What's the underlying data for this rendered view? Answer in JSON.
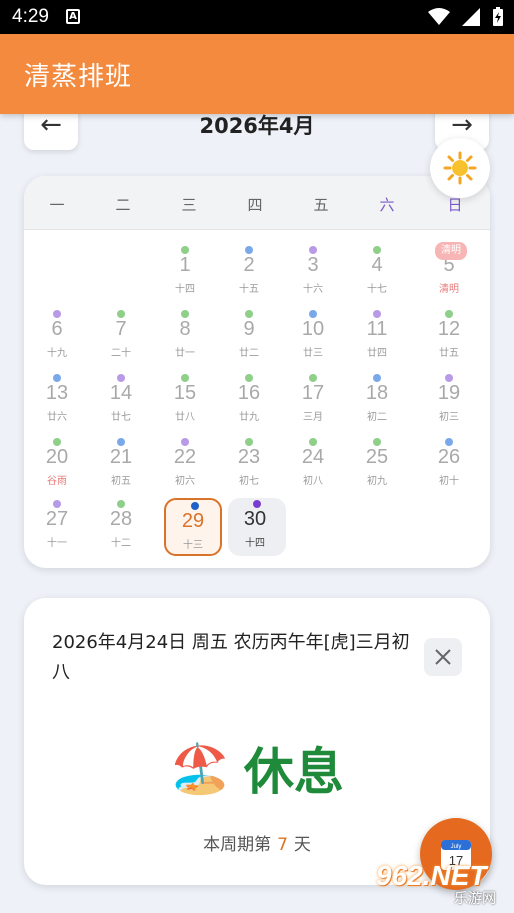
{
  "status_bar": {
    "time": "4:29",
    "notification_letter": "A"
  },
  "app": {
    "title": "清蒸排班",
    "accent_color": "#f48a3d"
  },
  "calendar": {
    "month_title": "2026年4月",
    "prev_label": "←",
    "next_label": "→",
    "theme_icon": "sun-icon",
    "weekdays": [
      "一",
      "二",
      "三",
      "四",
      "五",
      "六",
      "日"
    ],
    "days": [
      {
        "num": "1",
        "lunar": "十四",
        "dot": "#8fcf8a"
      },
      {
        "num": "2",
        "lunar": "十五",
        "dot": "#7aa8ea"
      },
      {
        "num": "3",
        "lunar": "十六",
        "dot": "#b99ae6"
      },
      {
        "num": "4",
        "lunar": "十七",
        "dot": "#8fcf8a"
      },
      {
        "num": "5",
        "lunar": "清明",
        "dot": "",
        "term": true,
        "holiday_badge": "清明"
      },
      {
        "num": "6",
        "lunar": "十九",
        "dot": "#b99ae6"
      },
      {
        "num": "7",
        "lunar": "二十",
        "dot": "#8fcf8a"
      },
      {
        "num": "8",
        "lunar": "廿一",
        "dot": "#8fcf8a"
      },
      {
        "num": "9",
        "lunar": "廿二",
        "dot": "#8fcf8a"
      },
      {
        "num": "10",
        "lunar": "廿三",
        "dot": "#7aa8ea"
      },
      {
        "num": "11",
        "lunar": "廿四",
        "dot": "#b99ae6"
      },
      {
        "num": "12",
        "lunar": "廿五",
        "dot": "#8fcf8a"
      },
      {
        "num": "13",
        "lunar": "廿六",
        "dot": "#7aa8ea"
      },
      {
        "num": "14",
        "lunar": "廿七",
        "dot": "#b99ae6"
      },
      {
        "num": "15",
        "lunar": "廿八",
        "dot": "#8fcf8a"
      },
      {
        "num": "16",
        "lunar": "廿九",
        "dot": "#8fcf8a"
      },
      {
        "num": "17",
        "lunar": "三月",
        "dot": "#8fcf8a"
      },
      {
        "num": "18",
        "lunar": "初二",
        "dot": "#7aa8ea"
      },
      {
        "num": "19",
        "lunar": "初三",
        "dot": "#b99ae6"
      },
      {
        "num": "20",
        "lunar": "谷雨",
        "dot": "#8fcf8a",
        "term": true
      },
      {
        "num": "21",
        "lunar": "初五",
        "dot": "#7aa8ea"
      },
      {
        "num": "22",
        "lunar": "初六",
        "dot": "#b99ae6"
      },
      {
        "num": "23",
        "lunar": "初七",
        "dot": "#8fcf8a"
      },
      {
        "num": "24",
        "lunar": "初八",
        "dot": "#8fcf8a"
      },
      {
        "num": "25",
        "lunar": "初九",
        "dot": "#8fcf8a"
      },
      {
        "num": "26",
        "lunar": "初十",
        "dot": "#7aa8ea"
      },
      {
        "num": "27",
        "lunar": "十一",
        "dot": "#b99ae6"
      },
      {
        "num": "28",
        "lunar": "十二",
        "dot": "#8fcf8a"
      },
      {
        "num": "29",
        "lunar": "十三",
        "dot": "#1f5fc8",
        "today": true
      },
      {
        "num": "30",
        "lunar": "十四",
        "dot": "#7a3fd0",
        "selected": true
      }
    ]
  },
  "detail": {
    "date_text": "2026年4月24日 周五 农历丙午年[虎]三月初八",
    "status_emoji": "🏖️",
    "status_text": "休息",
    "cycle_prefix": "本周期第",
    "cycle_num": "7",
    "cycle_suffix": "天"
  },
  "fab": {
    "icon": "calendar-icon",
    "month_label": "July",
    "day_label": "17"
  },
  "watermark": {
    "brand": "962.NET",
    "sub": "乐游网"
  }
}
